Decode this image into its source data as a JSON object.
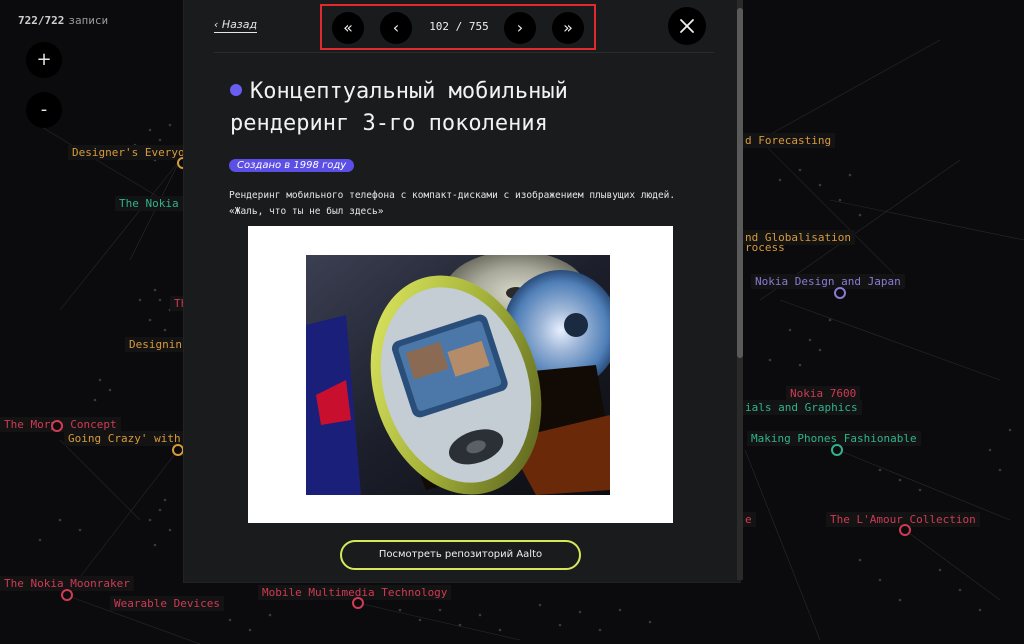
{
  "header": {
    "records_count": "722/722",
    "records_label": "записи"
  },
  "zoom": {
    "in_label": "+",
    "out_label": "-"
  },
  "graph_labels": [
    {
      "text": "Designer's Everyo",
      "color": "orange"
    },
    {
      "text": "The Nokia",
      "color": "teal"
    },
    {
      "text": "Th",
      "color": "red"
    },
    {
      "text": "Designin",
      "color": "orange"
    },
    {
      "text": "The Morph Concept",
      "color": "red"
    },
    {
      "text": "Going Crazy' with",
      "color": "orange"
    },
    {
      "text": "The Nokia Moonraker",
      "color": "red"
    },
    {
      "text": "Wearable Devices",
      "color": "red"
    },
    {
      "text": "Mobile Multimedia Technology",
      "color": "red"
    },
    {
      "text": "d Forecasting",
      "color": "orange"
    },
    {
      "text": "nd Globalisation",
      "color": "orange"
    },
    {
      "text": "rocess",
      "color": "orange"
    },
    {
      "text": "Nokia Design and Japan",
      "color": "purple"
    },
    {
      "text": "Nokia 7600",
      "color": "red"
    },
    {
      "text": "ials and Graphics",
      "color": "teal"
    },
    {
      "text": "Making Phones Fashionable",
      "color": "teal"
    },
    {
      "text": "e",
      "color": "red"
    },
    {
      "text": "The L'Amour Collection",
      "color": "red"
    }
  ],
  "modal": {
    "back_label": "‹ Назад",
    "pager": {
      "first": "«",
      "prev": "‹",
      "status": "102 / 755",
      "next": "›",
      "last": "»"
    },
    "close_icon": "close-icon",
    "title": "Концептуальный мобильный рендеринг 3-го поколения",
    "accent_color": "#6a5df2",
    "year_badge": "Создано в 1998 году",
    "description": "Рендеринг мобильного телефона с компакт-дисками с изображением плывущих людей. «Жаль, что ты не был здесь»",
    "repo_button": "Посмотреть репозиторий Aalto",
    "repo_button_color": "#d6e85a",
    "pager_highlight_color": "#e02a2f"
  }
}
